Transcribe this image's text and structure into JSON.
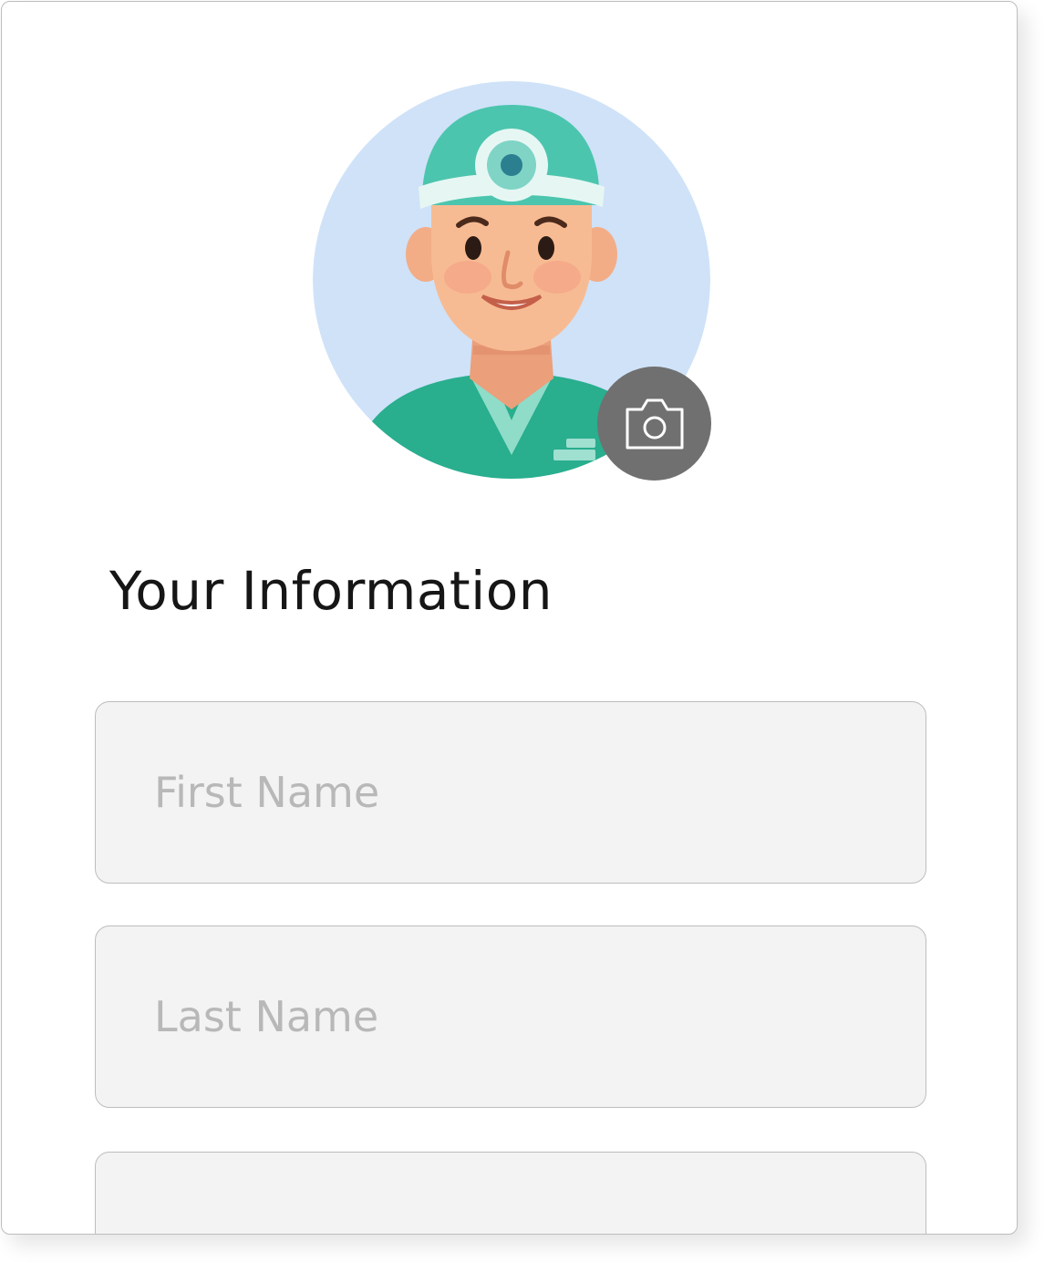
{
  "profile": {
    "avatar_icon": "doctor-avatar",
    "camera_icon": "camera-icon",
    "colors": {
      "avatar_bg": "#cfe2f8",
      "scrubs": "#29ae8e",
      "camera_button": "#707070"
    }
  },
  "form": {
    "title": "Your Information",
    "first_name": {
      "value": "",
      "placeholder": "First Name"
    },
    "last_name": {
      "value": "",
      "placeholder": "Last Name"
    },
    "third_field": {
      "value": "",
      "placeholder": ""
    }
  }
}
